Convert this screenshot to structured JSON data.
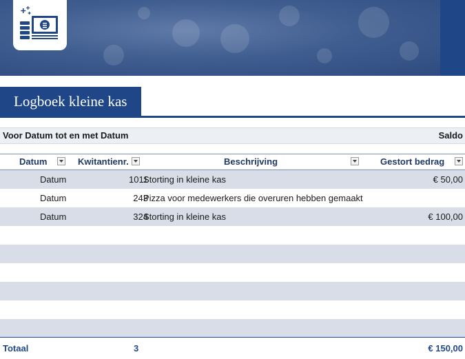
{
  "colors": {
    "primary": "#1f4788",
    "band": "#d9dde8",
    "header_text": "#1f3864"
  },
  "header": {
    "logo_icon": "money-icon",
    "title": "Logboek kleine kas"
  },
  "period": {
    "label": "Voor Datum tot en met Datum",
    "balance_label": "Saldo"
  },
  "table": {
    "columns": [
      {
        "key": "date",
        "label": "Datum"
      },
      {
        "key": "receipt",
        "label": "Kwitantienr."
      },
      {
        "key": "description",
        "label": "Beschrijving"
      },
      {
        "key": "deposit",
        "label": "Gestort bedrag"
      }
    ],
    "rows": [
      {
        "date": "Datum",
        "receipt": "1011",
        "description": "Storting in kleine kas",
        "deposit": "€ 50,00"
      },
      {
        "date": "Datum",
        "receipt": "243",
        "description": "Pizza voor medewerkers die overuren hebben gemaakt",
        "deposit": ""
      },
      {
        "date": "Datum",
        "receipt": "324",
        "description": "Storting in kleine kas",
        "deposit": "€ 100,00"
      },
      {
        "date": "",
        "receipt": "",
        "description": "",
        "deposit": ""
      },
      {
        "date": "",
        "receipt": "",
        "description": "",
        "deposit": ""
      },
      {
        "date": "",
        "receipt": "",
        "description": "",
        "deposit": ""
      },
      {
        "date": "",
        "receipt": "",
        "description": "",
        "deposit": ""
      },
      {
        "date": "",
        "receipt": "",
        "description": "",
        "deposit": ""
      },
      {
        "date": "",
        "receipt": "",
        "description": "",
        "deposit": ""
      }
    ]
  },
  "totals": {
    "label": "Totaal",
    "count": "3",
    "amount": "€ 150,00"
  }
}
